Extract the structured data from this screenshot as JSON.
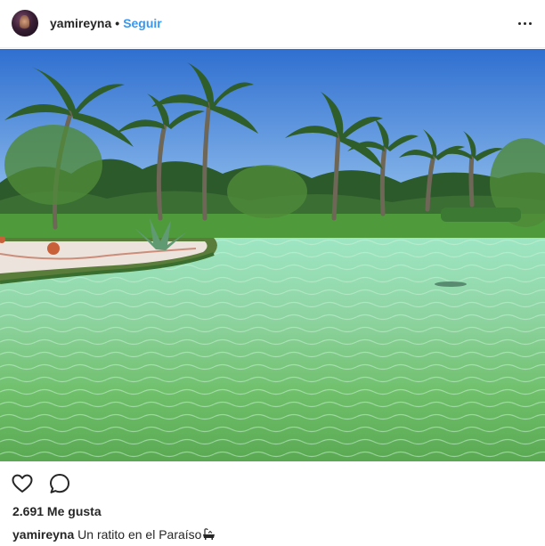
{
  "post": {
    "username": "yamireyna",
    "separator": "•",
    "follow_label": "Seguir",
    "more_icon": "more-horizontal-icon",
    "image_icon": "photo",
    "actions": {
      "like_icon": "heart-icon",
      "comment_icon": "comment-icon"
    },
    "likes": "2.691 Me gusta",
    "caption": {
      "username": "yamireyna",
      "text": "Un ratito en el Paraíso",
      "emoji_icon": "bathtub-emoji"
    }
  },
  "colors": {
    "link": "#3897f0",
    "text": "#262626",
    "divider": "#efefef"
  }
}
